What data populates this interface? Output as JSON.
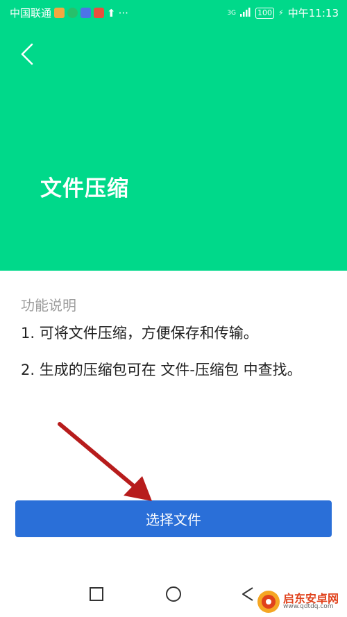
{
  "colors": {
    "hero": "#00d98a",
    "button": "#2a6fd8",
    "arrow": "#b71c1c"
  },
  "status_bar": {
    "carrier": "中国联通",
    "more": "···",
    "network": "3G",
    "battery": "100",
    "time": "中午11:13"
  },
  "header": {
    "back_icon": "chevron-left-icon",
    "title": "文件压缩"
  },
  "content": {
    "section_label": "功能说明",
    "items": [
      "1. 可将文件压缩，方便保存和传输。",
      "2. 生成的压缩包可在 文件-压缩包 中查找。"
    ]
  },
  "actions": {
    "select_label": "选择文件"
  },
  "nav": {
    "icons": [
      "square-icon",
      "circle-icon",
      "triangle-back-icon"
    ]
  },
  "watermark": {
    "title": "启东安卓网",
    "url": "www.qdtdq.com"
  }
}
